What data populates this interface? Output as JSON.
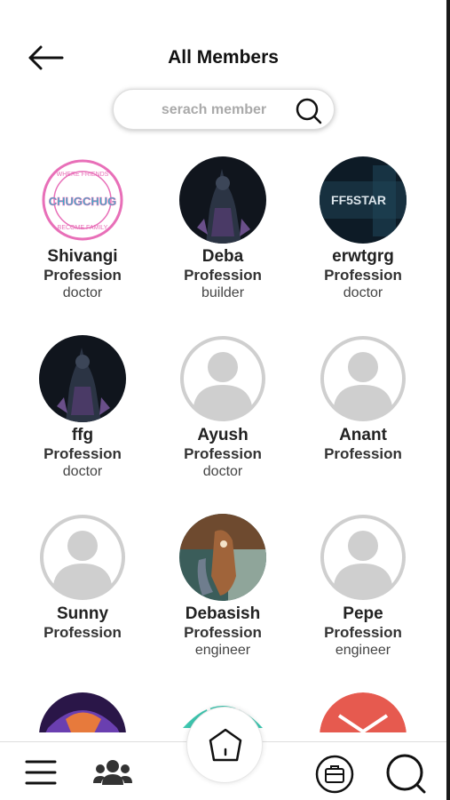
{
  "header": {
    "title": "All Members"
  },
  "search": {
    "placeholder": "serach member"
  },
  "members": [
    {
      "name": "Shivangi",
      "profession_label": "Profession",
      "occupation": "doctor",
      "avatar": "logo-avatar"
    },
    {
      "name": "Deba",
      "profession_label": "Profession",
      "occupation": "builder",
      "avatar": "dark-hero-avatar"
    },
    {
      "name": "erwtgrg",
      "profession_label": "Profession",
      "occupation": "doctor",
      "avatar": "ff5star-avatar"
    },
    {
      "name": "ffg",
      "profession_label": "Profession",
      "occupation": "doctor",
      "avatar": "dark-hero-avatar"
    },
    {
      "name": "Ayush",
      "profession_label": "Profession",
      "occupation": "doctor",
      "avatar": "default-avatar"
    },
    {
      "name": "Anant",
      "profession_label": "Profession",
      "occupation": "",
      "avatar": "default-avatar"
    },
    {
      "name": "Sunny",
      "profession_label": "Profession",
      "occupation": "",
      "avatar": "default-avatar"
    },
    {
      "name": "Debasish",
      "profession_label": "Profession",
      "occupation": "engineer",
      "avatar": "cartoon-avatar"
    },
    {
      "name": "Pepe",
      "profession_label": "Profession",
      "occupation": "engineer",
      "avatar": "default-avatar"
    }
  ],
  "avatar_text": {
    "ff5star": "FF5STAR",
    "logo_top": "WHERE FRIENDS",
    "logo_mid": "CHUGCHUG",
    "logo_bottom": "BECOME FAMILY"
  },
  "bottom_nav": {
    "items": [
      "menu-icon",
      "members-icon",
      "home-icon",
      "briefcase-icon",
      "search-icon"
    ]
  },
  "colors": {
    "accent_teal": "#2bb5c9",
    "logo_pink": "#e86fb8",
    "default_avatar_gray": "#cfcfcf"
  }
}
